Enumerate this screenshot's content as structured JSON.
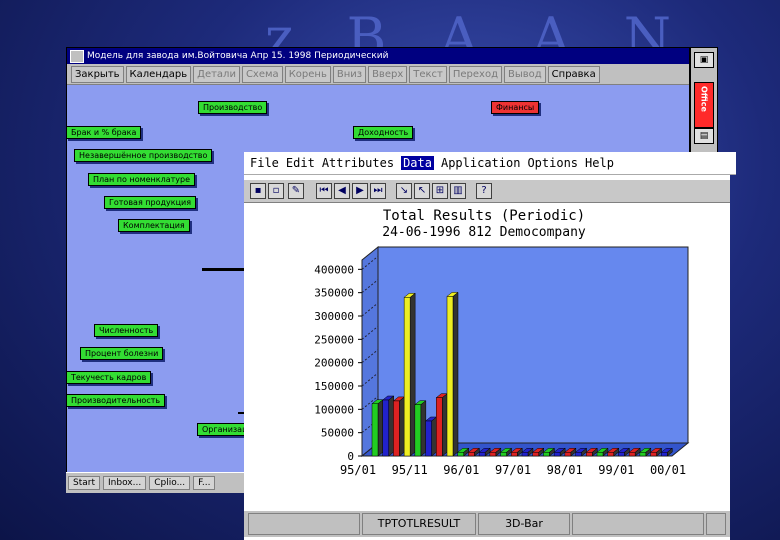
{
  "background_window": {
    "title": "Модель для завода им.Войтовича  Апр 15. 1998  Периодический",
    "menu": [
      "Закрыть",
      "Календарь",
      "Детали",
      "Схема",
      "Корень",
      "Вниз",
      "Вверх",
      "Текст",
      "Переход",
      "Вывод",
      "Справка"
    ],
    "menu_dim": [
      false,
      false,
      true,
      true,
      true,
      true,
      true,
      true,
      true,
      true,
      false
    ],
    "nodes": [
      {
        "label": "Производство",
        "red": false
      },
      {
        "label": "Финансы",
        "red": true
      },
      {
        "label": "Брак и % брака",
        "red": false
      },
      {
        "label": "Доходность",
        "red": false
      },
      {
        "label": "Незавершённое производство",
        "red": false
      },
      {
        "label": "План по номенклатуре",
        "red": false
      },
      {
        "label": "Готовая продукция",
        "red": false
      },
      {
        "label": "Комплектация",
        "red": false
      },
      {
        "label": "Численность",
        "red": false
      },
      {
        "label": "Процент болезни",
        "red": false
      },
      {
        "label": "Текучесть кадров",
        "red": false
      },
      {
        "label": "Производительность",
        "red": false
      },
      {
        "label": "Организация",
        "red": false
      }
    ],
    "taskbar": [
      "Start",
      "Inbox...",
      "Cplio...",
      "F..."
    ]
  },
  "right_toolbar": {
    "office_label": "Office"
  },
  "chart_window": {
    "menu": [
      "File",
      "Edit",
      "Attributes",
      "Data",
      "Application",
      "Options",
      "Help"
    ],
    "selected_menu": "Data",
    "status": {
      "name": "TPTOTLRESULT",
      "chart_kind": "3D-Bar"
    }
  },
  "chart_data": {
    "type": "bar",
    "title": "Total Results (Periodic)",
    "subtitle": "24-06-1996   812 Democompany",
    "categories": [
      "95/01",
      "95/11",
      "96/01",
      "97/01",
      "98/01",
      "99/01",
      "00/01"
    ],
    "yticks": [
      0,
      50000,
      100000,
      150000,
      200000,
      250000,
      300000,
      350000,
      400000
    ],
    "ylim": [
      0,
      420000
    ],
    "bars": [
      {
        "color": "#22cc22",
        "value": 112000
      },
      {
        "color": "#2222cc",
        "value": 120000
      },
      {
        "color": "#dd2222",
        "value": 118000
      },
      {
        "color": "#eeee22",
        "value": 340000
      },
      {
        "color": "#22cc22",
        "value": 110000
      },
      {
        "color": "#2222cc",
        "value": 75000
      },
      {
        "color": "#dd2222",
        "value": 125000
      },
      {
        "color": "#eeee22",
        "value": 342000
      },
      {
        "color": "#22cc22",
        "value": 8000
      },
      {
        "color": "#dd2222",
        "value": 8000
      },
      {
        "color": "#2222cc",
        "value": 8000
      },
      {
        "color": "#dd2222",
        "value": 8000
      },
      {
        "color": "#22cc22",
        "value": 8000
      },
      {
        "color": "#dd2222",
        "value": 8000
      },
      {
        "color": "#2222cc",
        "value": 8000
      },
      {
        "color": "#dd2222",
        "value": 8000
      },
      {
        "color": "#22cc22",
        "value": 8000
      },
      {
        "color": "#2222cc",
        "value": 8000
      },
      {
        "color": "#dd2222",
        "value": 8000
      },
      {
        "color": "#2222cc",
        "value": 8000
      },
      {
        "color": "#dd2222",
        "value": 8000
      },
      {
        "color": "#22cc22",
        "value": 8000
      },
      {
        "color": "#dd2222",
        "value": 8000
      },
      {
        "color": "#2222cc",
        "value": 8000
      },
      {
        "color": "#dd2222",
        "value": 8000
      },
      {
        "color": "#22cc22",
        "value": 8000
      },
      {
        "color": "#dd2222",
        "value": 8000
      },
      {
        "color": "#2222cc",
        "value": 8000
      }
    ],
    "colors": {
      "wall": "#6688ee",
      "floor": "#3355cc",
      "ink": "#000000"
    }
  }
}
